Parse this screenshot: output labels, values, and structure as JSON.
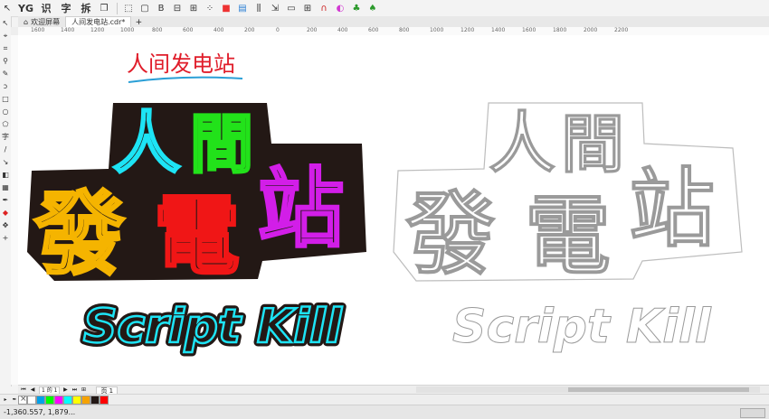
{
  "toolbar": {
    "labels": [
      "识",
      "字",
      "拆"
    ],
    "yg_label": "YG"
  },
  "tabs": [
    {
      "label": "欢迎屏幕"
    },
    {
      "label": "人间发电站.cdr*"
    }
  ],
  "ruler": {
    "ticks": [
      "1600",
      "1400",
      "1200",
      "1000",
      "800",
      "600",
      "400",
      "200",
      "0",
      "200",
      "400",
      "600",
      "800",
      "1000",
      "1200",
      "1400",
      "1600",
      "1800",
      "2000",
      "2200"
    ]
  },
  "artwork": {
    "handwritten_title": "人间发电站",
    "glyph_ren": "人",
    "glyph_jian": "間",
    "glyph_fa": "發",
    "glyph_dian": "電",
    "glyph_zhan": "站",
    "script_text": "Script Kill",
    "colors": {
      "ren": "#1de4f5",
      "jian": "#22e21a",
      "fa": "#f5b400",
      "dian": "#f01616",
      "zhan": "#d21ee8",
      "script": "#1de4f5",
      "backdrop": "#231815",
      "title": "#e01d2a",
      "title_underline": "#2a9fd6"
    }
  },
  "pagebar": {
    "page_counter": "1 的 1",
    "page_tab": "页 1"
  },
  "palette": {
    "colors": [
      "#ffffff",
      "#00a0e9",
      "#00ff00",
      "#ff00ff",
      "#00ffff",
      "#ffff00",
      "#f5a200",
      "#231815",
      "#ff0000"
    ]
  },
  "status": {
    "coordinates": "-1,360.557, 1,879..."
  }
}
